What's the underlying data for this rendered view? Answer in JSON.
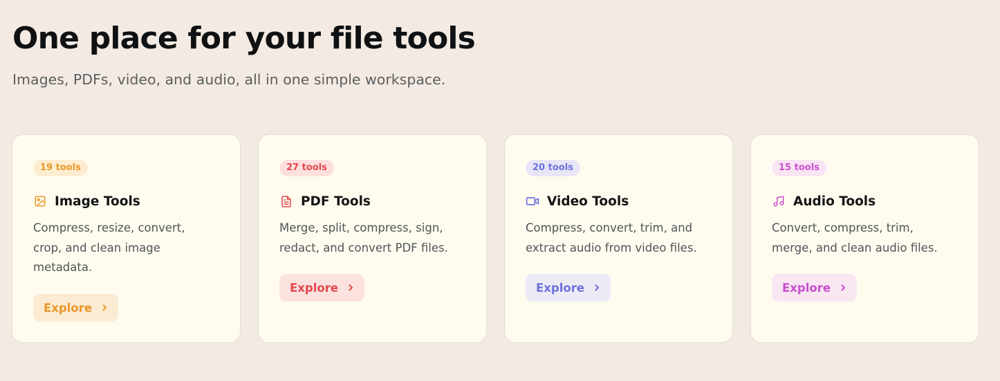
{
  "header": {
    "title": "One place for your file tools",
    "subtitle": "Images, PDFs, video, and audio, all in one simple workspace."
  },
  "cards": [
    {
      "badge": "19 tools",
      "icon": "image-icon",
      "title": "Image Tools",
      "description": "Compress, resize, convert, crop, and clean image metadata.",
      "cta": "Explore",
      "accent": "#e8982a",
      "badge_bg": "#fdedd0",
      "cta_bg": "#fbebd3"
    },
    {
      "badge": "27 tools",
      "icon": "file-text-icon",
      "title": "PDF Tools",
      "description": "Merge, split, compress, sign, redact, and convert PDF files.",
      "cta": "Explore",
      "accent": "#e5484d",
      "badge_bg": "#fde0de",
      "cta_bg": "#fbe2df"
    },
    {
      "badge": "20 tools",
      "icon": "video-icon",
      "title": "Video Tools",
      "description": "Compress, convert, trim, and extract audio from video files.",
      "cta": "Explore",
      "accent": "#6d72dc",
      "badge_bg": "#e8e6f6",
      "cta_bg": "#ecebf5"
    },
    {
      "badge": "15 tools",
      "icon": "music-note-icon",
      "title": "Audio Tools",
      "description": "Convert, compress, trim, merge, and clean audio files.",
      "cta": "Explore",
      "accent": "#c94fd0",
      "badge_bg": "#f8e4f2",
      "cta_bg": "#f8e6f1"
    }
  ]
}
